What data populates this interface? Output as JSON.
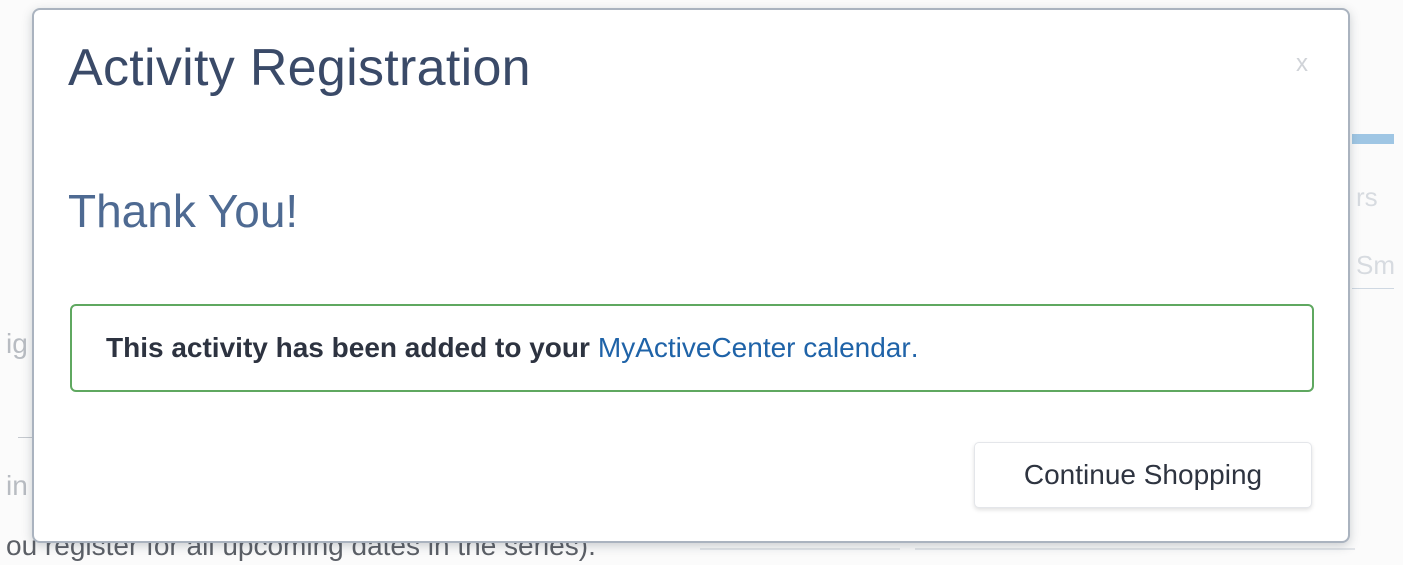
{
  "modal": {
    "title": "Activity Registration",
    "close_label": "x",
    "heading": "Thank You!",
    "alert": {
      "text": "This activity has been added to your",
      "link_text": "MyActiveCenter calendar",
      "suffix": "."
    },
    "continue_button": "Continue Shopping"
  },
  "background": {
    "right_fragment_1": "rs",
    "right_fragment_2": "Sm",
    "left_fragment_1": "ig",
    "left_fragment_2": "in",
    "bottom_text": "ou register for all upcoming dates in the series)."
  },
  "colors": {
    "title": "#3a4a68",
    "heading": "#4e6a92",
    "alert_border": "#5fa860",
    "link": "#1f63a8"
  }
}
